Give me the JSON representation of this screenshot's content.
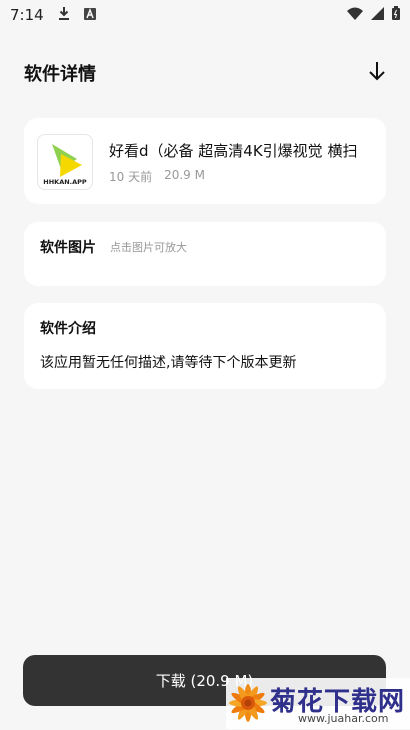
{
  "status_bar": {
    "time": "7:14",
    "icons": [
      "download-icon",
      "a-icon",
      "wifi-icon",
      "signal-icon",
      "battery-icon"
    ]
  },
  "header": {
    "title": "软件详情",
    "action_icon": "arrow-down-icon"
  },
  "app": {
    "name": "好看d（必备 超高清4K引爆视觉 横扫",
    "icon_text": "HHKAN.APP",
    "age": "10 天前",
    "size": "20.9 M"
  },
  "images_section": {
    "title": "软件图片",
    "hint": "点击图片可放大"
  },
  "intro_section": {
    "title": "软件介绍",
    "text": "该应用暂无任何描述,请等待下个版本更新"
  },
  "download": {
    "label": "下载 (20.9 M)"
  },
  "watermark": {
    "title": "菊花下载网",
    "url": "www.juahar.com"
  },
  "colors": {
    "background": "#f6f6f6",
    "card": "#ffffff",
    "button": "#333333",
    "icon_yellow": "#f5d800",
    "icon_green": "#8fd14f",
    "watermark_text": "#2f2f8c"
  }
}
